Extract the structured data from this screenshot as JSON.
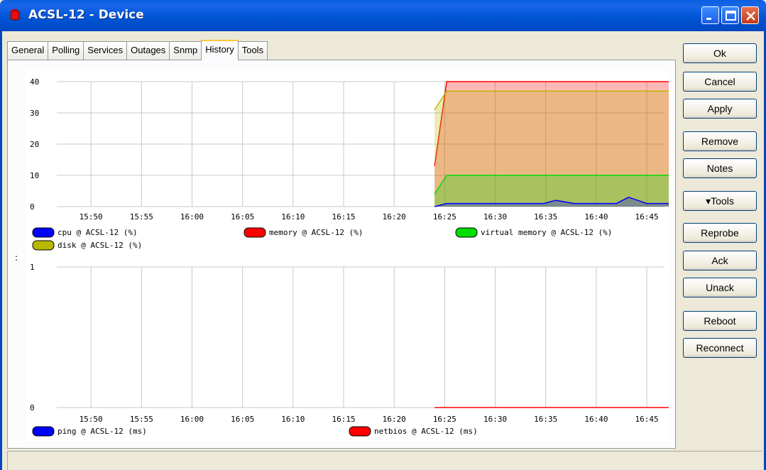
{
  "window": {
    "title": "ACSL-12 - Device"
  },
  "tabs": [
    {
      "label": "General",
      "active": false
    },
    {
      "label": "Polling",
      "active": false
    },
    {
      "label": "Services",
      "active": false
    },
    {
      "label": "Outages",
      "active": false
    },
    {
      "label": "Snmp",
      "active": false
    },
    {
      "label": "History",
      "active": true
    },
    {
      "label": "Tools",
      "active": false
    }
  ],
  "buttons": {
    "ok": "Ok",
    "cancel": "Cancel",
    "apply": "Apply",
    "remove": "Remove",
    "notes": "Notes",
    "tools": "▾Tools",
    "reprobe": "Reprobe",
    "ack": "Ack",
    "unack": "Unack",
    "reboot": "Reboot",
    "reconnect": "Reconnect"
  },
  "splitter": {
    "glyph": ":"
  },
  "chart_data": [
    {
      "type": "area",
      "x": [
        "15:50",
        "15:55",
        "16:00",
        "16:05",
        "16:10",
        "16:15",
        "16:20",
        "16:25",
        "16:30",
        "16:35",
        "16:40",
        "16:45"
      ],
      "ylim": [
        0,
        40
      ],
      "yticks": [
        "40",
        "30",
        "20",
        "10",
        "0"
      ],
      "grid": true,
      "series": [
        {
          "name": "cpu @ ACSL-12 (%)",
          "color": "#0000ff",
          "points": [
            [
              16.4,
              0
            ],
            [
              16.42,
              1
            ],
            [
              16.58,
              1
            ],
            [
              16.6,
              2
            ],
            [
              16.63,
              1
            ],
            [
              16.7,
              1
            ],
            [
              16.72,
              3
            ],
            [
              16.75,
              1
            ],
            [
              16.8,
              1
            ]
          ]
        },
        {
          "name": "memory @ ACSL-12 (%)",
          "color": "#ff0000",
          "points": [
            [
              16.4,
              13
            ],
            [
              16.42,
              40
            ],
            [
              16.8,
              40
            ],
            [
              16.82,
              27
            ]
          ]
        },
        {
          "name": "virtual memory @ ACSL-12 (%)",
          "color": "#00dd00",
          "points": [
            [
              16.4,
              4
            ],
            [
              16.42,
              10
            ],
            [
              16.82,
              10
            ],
            [
              16.83,
              6
            ]
          ]
        },
        {
          "name": "disk @ ACSL-12 (%)",
          "color": "#b8b800",
          "points": [
            [
              16.4,
              31
            ],
            [
              16.42,
              37
            ],
            [
              16.8,
              37
            ],
            [
              16.82,
              6
            ]
          ]
        }
      ]
    },
    {
      "type": "line",
      "x": [
        "15:50",
        "15:55",
        "16:00",
        "16:05",
        "16:10",
        "16:15",
        "16:20",
        "16:25",
        "16:30",
        "16:35",
        "16:40",
        "16:45"
      ],
      "ylim": [
        0,
        1
      ],
      "yticks": [
        "1",
        "0"
      ],
      "grid": true,
      "series": [
        {
          "name": "ping @ ACSL-12 (ms)",
          "color": "#0000ff",
          "points": []
        },
        {
          "name": "netbios @ ACSL-12 (ms)",
          "color": "#ff0000",
          "points": [
            [
              16.4,
              0
            ],
            [
              16.83,
              0
            ]
          ]
        }
      ]
    }
  ]
}
